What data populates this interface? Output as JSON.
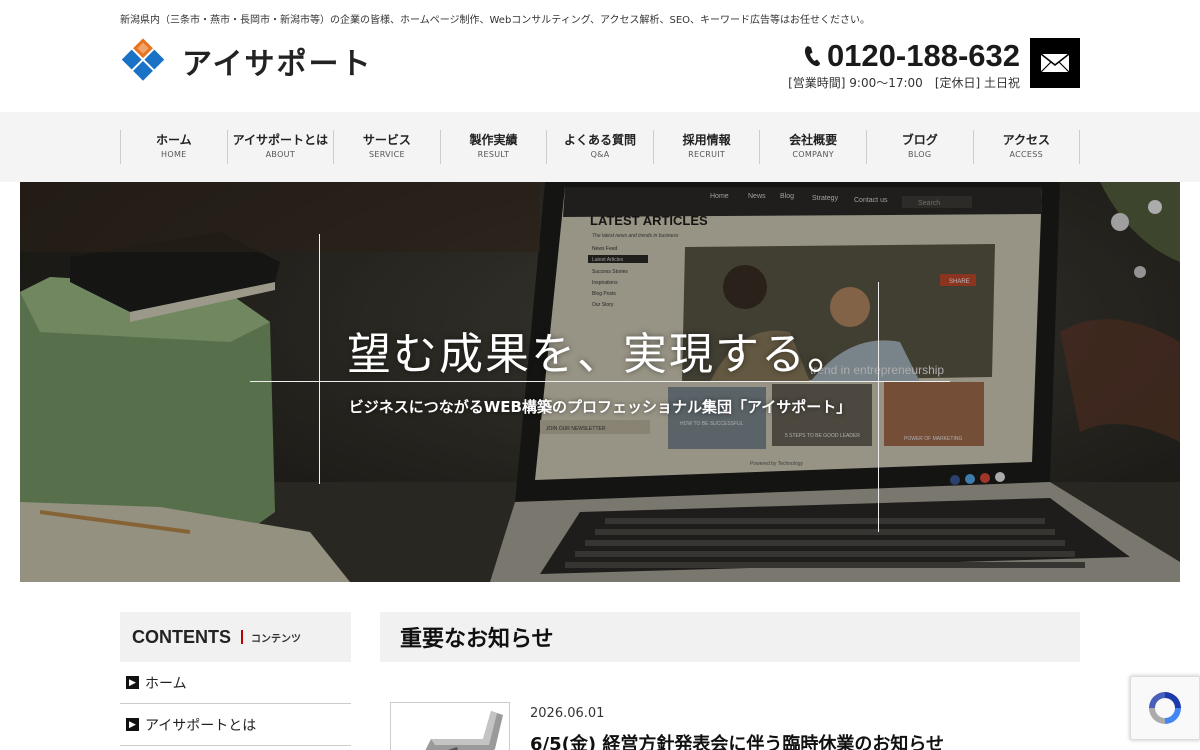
{
  "header": {
    "tagline": "新潟県内（三条市・燕市・長岡市・新潟市等）の企業の皆様、ホームページ制作、Webコンサルティング、アクセス解析、SEO、キーワード広告等はお任せください。",
    "logo_text": "アイサポート",
    "phone": "0120-188-632",
    "hours": "[営業時間] 9:00～17:00",
    "holiday": "[定休日] 土日祝"
  },
  "nav": [
    {
      "ja": "ホーム",
      "en": "HOME"
    },
    {
      "ja": "アイサポートとは",
      "en": "ABOUT"
    },
    {
      "ja": "サービス",
      "en": "SERVICE"
    },
    {
      "ja": "製作実績",
      "en": "RESULT"
    },
    {
      "ja": "よくある質問",
      "en": "Q&A"
    },
    {
      "ja": "採用情報",
      "en": "RECRUIT"
    },
    {
      "ja": "会社概要",
      "en": "COMPANY"
    },
    {
      "ja": "ブログ",
      "en": "BLOG"
    },
    {
      "ja": "アクセス",
      "en": "ACCESS"
    }
  ],
  "hero": {
    "title": "望む成果を、実現する。",
    "subtitle": "ビジネスにつながるWEB構築のプロフェッショナル集団「アイサポート」",
    "screen": {
      "heading": "LATEST ARTICLES",
      "tagline": "The latest news and trends in business",
      "menu": [
        "Home",
        "News",
        "Blog",
        "Strategy",
        "Contact us"
      ],
      "search": "Search",
      "sidebar": [
        "News Feed",
        "Latest Articles",
        "Success Stories",
        "Inspirations",
        "Blog Posts",
        "Our Story"
      ],
      "photo_caption": "trend in entrepreneurship",
      "share": "SHARE",
      "card1": "HOW TO BE SUCCESSFUL",
      "card2": "5 STEPS TO BE GOOD LEADER",
      "card3": "POWER OF MARKETING",
      "newsletter": "JOIN OUR NEWSLETTER",
      "footer": "Powered by Technology"
    }
  },
  "sidebar": {
    "title": "CONTENTS",
    "subtitle": "コンテンツ",
    "items": [
      "ホーム",
      "アイサポートとは"
    ]
  },
  "main": {
    "heading": "重要なお知らせ",
    "news": [
      {
        "date": "2026.06.01",
        "title": "6/5(金) 経営方針発表会に伴う臨時休業のお知らせ"
      }
    ]
  },
  "colors": {
    "logo_orange": "#e8731e",
    "logo_blue": "#1a72c6",
    "nav_bg": "#f4f4f4",
    "accent_red": "#bb0000"
  }
}
